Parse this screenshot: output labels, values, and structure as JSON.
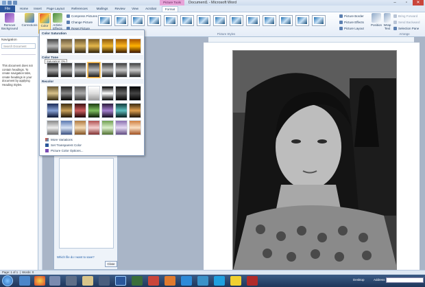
{
  "window": {
    "title": "Document1 - Microsoft Word",
    "context_tab": "Picture Tools"
  },
  "tabs": [
    "File",
    "Home",
    "Insert",
    "Page Layout",
    "References",
    "Mailings",
    "Review",
    "View",
    "Acrobat",
    "Format"
  ],
  "ribbon": {
    "remove_bg": "Remove Background",
    "corrections": "Corrections",
    "color": "Color",
    "artistic": "Artistic Effects",
    "compress": "Compress Pictures",
    "change": "Change Picture",
    "reset": "Reset Picture",
    "picture_border": "Picture Border",
    "picture_effects": "Picture Effects",
    "picture_layout": "Picture Layout",
    "position": "Position",
    "wrap_text": "Wrap Text",
    "bring_forward": "Bring Forward",
    "send_backward": "Send Backward",
    "selection_pane": "Selection Pane",
    "group_picture_styles": "Picture Styles",
    "group_arrange": "Arrange"
  },
  "nav": {
    "title": "Navigation",
    "search_placeholder": "Search Document",
    "body": "This document does not contain headings. To create navigation tabs, create headings in your document by applying Heading Styles."
  },
  "gallery": {
    "heading_saturation": "Color Saturation",
    "heading_tone": "Color Tone",
    "heading_recolor": "Recolor",
    "tooltip": "Saturation: 0%",
    "more_variations": "More Variations",
    "set_transparent": "Set Transparent Color",
    "color_options": "Picture Color Options..."
  },
  "sidepane": {
    "help": "Which file do I want to save?",
    "close": "Close"
  },
  "status": {
    "page": "Page: 1 of 1",
    "words": "Words: 0"
  },
  "taskbar": {
    "desktop": "Desktop",
    "address": "Address"
  },
  "colors": {
    "accent": "#2b579a",
    "context": "#e7a3d8",
    "ribbon": "#e4ecf7"
  }
}
